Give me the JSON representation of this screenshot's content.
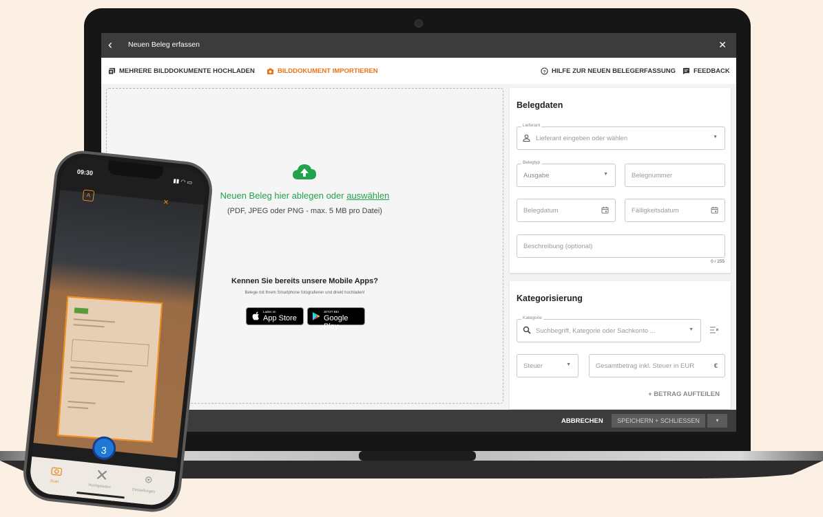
{
  "window": {
    "title": "Neuen Beleg erfassen",
    "back_glyph": "‹",
    "close_glyph": "✕"
  },
  "toolbar": {
    "upload_multi": "MEHRERE BILDDOKUMENTE HOCHLADEN",
    "import_single": "BILDDOKUMENT IMPORTIEREN",
    "help": "HILFE ZUR NEUEN BELEGERFASSUNG",
    "feedback": "FEEDBACK"
  },
  "dropzone": {
    "main_text": "Neuen Beleg hier ablegen oder ",
    "link_text": "auswählen",
    "sub_text": "(PDF, JPEG oder PNG - max. 5 MB pro Datei)",
    "apps_title": "Kennen Sie bereits unsere Mobile Apps?",
    "apps_sub": "Belege mit Ihrem Smartphone fotografieren und direkt hochladen!",
    "appstore_small": "Laden im",
    "appstore_big": "App Store",
    "googleplay_small": "JETZT BEI",
    "googleplay_big": "Google Play"
  },
  "belegdaten": {
    "title": "Belegdaten",
    "lieferant_label": "Lieferant",
    "lieferant_placeholder": "Lieferant eingeben oder wählen",
    "belegtyp_label": "Belegtyp",
    "belegtyp_value": "Ausgabe",
    "belegnummer_placeholder": "Belegnummer",
    "belegdatum_placeholder": "Belegdatum",
    "faelligkeit_placeholder": "Fälligkeitsdatum",
    "beschreibung_placeholder": "Beschreibung (optional)",
    "counter": "0 / 255"
  },
  "kategorisierung": {
    "title": "Kategorisierung",
    "kategorie_label": "Kategorie",
    "kategorie_placeholder": "Suchbegriff, Kategorie oder Sachkonto ...",
    "steuer_placeholder": "Steuer",
    "betrag_placeholder": "Gesamtbetrag inkl. Steuer in EUR",
    "currency": "€",
    "split_label": "+  BETRAG AUFTEILEN"
  },
  "footer": {
    "cancel_label": "ABBRECHEN",
    "save_label": "SPEICHERN + SCHLIESSEN",
    "save_caret": "▾"
  },
  "phone": {
    "time": "09:30",
    "status": "▮▮ ◠ ▭",
    "badge_count": "3",
    "nav": [
      "Scan",
      "Hochgeladen",
      "Einstellungen"
    ]
  },
  "colors": {
    "accent_orange": "#e8731a",
    "accent_green": "#22a24a",
    "topbar": "#3c3c3c"
  },
  "icons": [
    "back-icon",
    "close-icon",
    "upload-multi-icon",
    "camera-icon",
    "help-icon",
    "feedback-icon",
    "cloud-upload-icon",
    "apple-icon",
    "google-play-icon",
    "person-icon",
    "calendar-icon",
    "search-icon",
    "filter-icon"
  ]
}
